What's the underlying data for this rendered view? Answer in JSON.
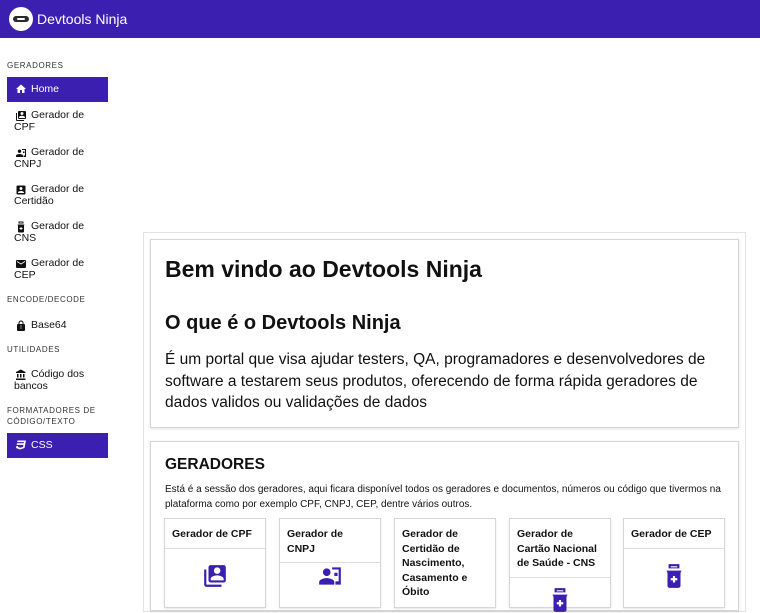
{
  "app": {
    "title": "Devtools Ninja"
  },
  "sidebar": {
    "sections": {
      "geradores": "GERADORES",
      "encode": "ENCODE/DECODE",
      "utilidades": "UTILIDADES",
      "formatadores_1": "FORMATADORES DE",
      "formatadores_2": "CÓDIGO/TEXTO"
    },
    "items": {
      "home": "Home",
      "cpf_1": "Gerador de",
      "cpf_2": "CPF",
      "cnpj_1": "Gerador de",
      "cnpj_2": "CNPJ",
      "certidao_1": "Gerador de",
      "certidao_2": "Certidão",
      "cns_1": "Gerador de",
      "cns_2": "CNS",
      "cep_1": "Gerador de",
      "cep_2": "CEP",
      "base64": "Base64",
      "bancos_1": "Código dos",
      "bancos_2": "bancos",
      "css": "CSS"
    }
  },
  "main": {
    "welcome": "Bem vindo ao Devtools Ninja",
    "about_title": "O que é o Devtools Ninja",
    "about_text": "É um portal que visa ajudar testers, QA, programadores e desenvolvedores de software a testarem seus produtos, oferecendo de forma rápida geradores de dados validos ou validações de dados",
    "geradores_title": "GERADORES",
    "geradores_text": "Está é a sessão dos geradores, aqui ficara disponível todos os geradores e documentos, números ou código que tivermos na plataforma como por exemplo CPF, CNPJ, CEP, dentre vários outros.",
    "tiles": {
      "cpf": "Gerador de CPF",
      "cnpj": "Gerador de CNPJ",
      "certidao": "Gerador de Certidão de Nascimento, Casamento e Óbito",
      "cns": "Gerador de Cartão Nacional de Saúde - CNS",
      "cep": "Gerador de CEP"
    }
  },
  "icons": [
    "home-icon",
    "id-card-icon",
    "contact-card-icon",
    "badge-icon",
    "medical-icon",
    "mail-icon",
    "lock-icon",
    "bank-icon",
    "css-icon"
  ],
  "colors": {
    "primary": "#3a1fb0"
  }
}
